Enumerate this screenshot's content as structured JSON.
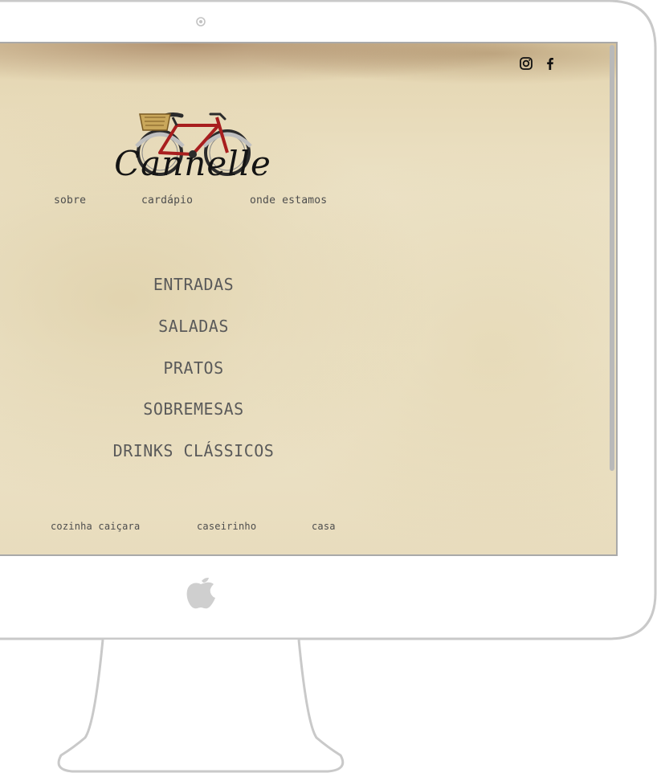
{
  "site": {
    "logo_text": "Cannelle",
    "social": [
      {
        "icon": "instagram-icon"
      },
      {
        "icon": "facebook-icon"
      }
    ]
  },
  "nav_top": {
    "items": [
      "sobre",
      "cardápio",
      "onde estamos"
    ]
  },
  "menu": {
    "categories": [
      "ENTRADAS",
      "SALADAS",
      "PRATOS",
      "SOBREMESAS",
      "DRINKS CLÁSSICOS"
    ]
  },
  "nav_bottom": {
    "items": [
      "cozinha caiçara",
      "caseirinho",
      "casa"
    ]
  },
  "colors": {
    "text": "#5a5a5a",
    "paper": "#ece2c6",
    "frame": "#c8c8c8",
    "bike_red": "#a81e1e"
  }
}
